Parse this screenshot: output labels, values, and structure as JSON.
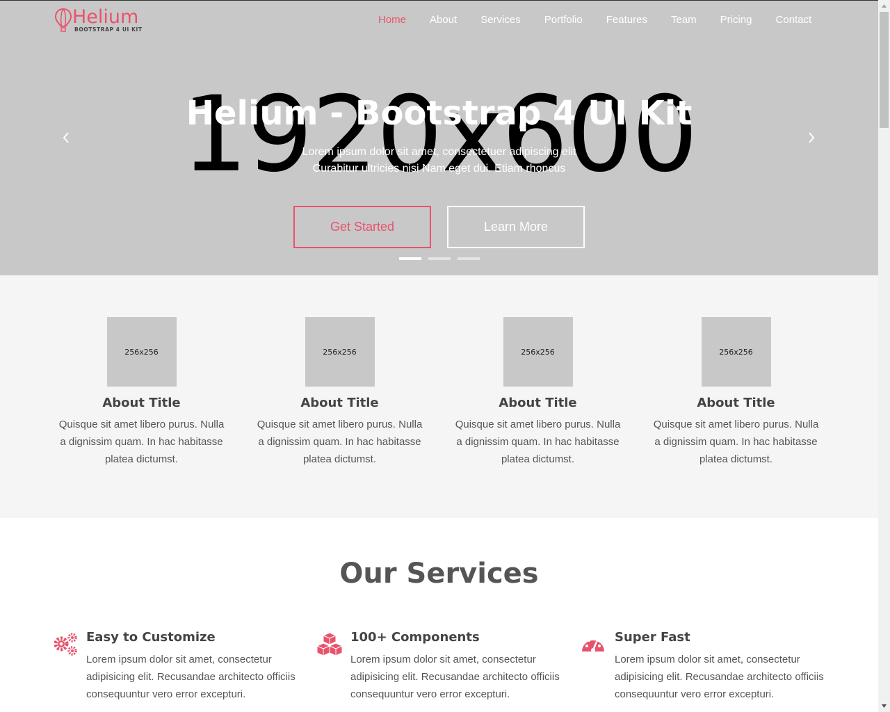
{
  "colors": {
    "accent": "#e9526c",
    "hero_bg": "#c8c8c8",
    "about_bg": "#f5f5f5",
    "text": "#555555"
  },
  "brand": {
    "name": "Helium",
    "tagline": "BOOTSTRAP 4 UI KIT",
    "icon": "hot-air-balloon-icon"
  },
  "nav": {
    "items": [
      {
        "label": "Home",
        "active": true
      },
      {
        "label": "About"
      },
      {
        "label": "Services"
      },
      {
        "label": "Portfolio"
      },
      {
        "label": "Features"
      },
      {
        "label": "Team"
      },
      {
        "label": "Pricing"
      },
      {
        "label": "Contact"
      }
    ]
  },
  "hero": {
    "placeholder": "1920x600",
    "title": "Helium - Bootstrap 4 UI Kit",
    "subtitle_line1": "Lorem ipsum dolor sit amet, consectetuer adipiscing elit",
    "subtitle_line2": "Curabitur ultricies nisi Nam eget dui. Etiam rhoncus",
    "primary_button": "Get Started",
    "secondary_button": "Learn More",
    "prev_icon": "chevron-left-icon",
    "next_icon": "chevron-right-icon",
    "slide_count": 3,
    "active_slide": 1
  },
  "about": {
    "cards": [
      {
        "image_label": "256x256",
        "title": "About Title",
        "text": "Quisque sit amet libero purus. Nulla a dignissim quam. In hac habitasse platea dictumst."
      },
      {
        "image_label": "256x256",
        "title": "About Title",
        "text": "Quisque sit amet libero purus. Nulla a dignissim quam. In hac habitasse platea dictumst."
      },
      {
        "image_label": "256x256",
        "title": "About Title",
        "text": "Quisque sit amet libero purus. Nulla a dignissim quam. In hac habitasse platea dictumst."
      },
      {
        "image_label": "256x256",
        "title": "About Title",
        "text": "Quisque sit amet libero purus. Nulla a dignissim quam. In hac habitasse platea dictumst."
      }
    ]
  },
  "services": {
    "title": "Our Services",
    "items": [
      {
        "icon": "gears-icon",
        "title": "Easy to Customize",
        "text": "Lorem ipsum dolor sit amet, consectetur adipisicing elit. Recusandae architecto officiis consequuntur vero error excepturi."
      },
      {
        "icon": "cubes-icon",
        "title": "100+ Components",
        "text": "Lorem ipsum dolor sit amet, consectetur adipisicing elit. Recusandae architecto officiis consequuntur vero error excepturi."
      },
      {
        "icon": "speedometer-icon",
        "title": "Super Fast",
        "text": "Lorem ipsum dolor sit amet, consectetur adipisicing elit. Recusandae architecto officiis consequuntur vero error excepturi."
      }
    ]
  }
}
